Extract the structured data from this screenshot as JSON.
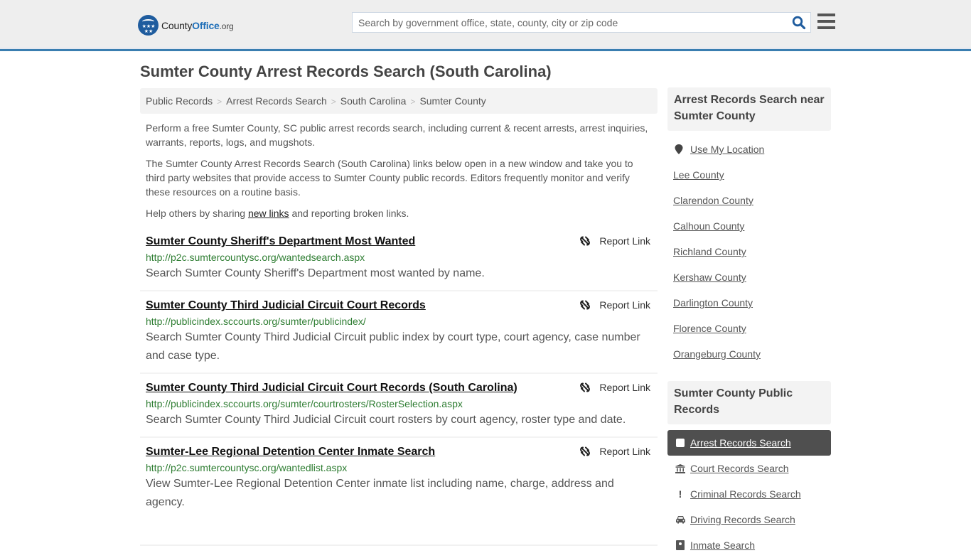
{
  "header": {
    "logo": {
      "name_part1": "County",
      "name_part2": "Office",
      "name_part3": ".org"
    },
    "search": {
      "placeholder": "Search by government office, state, county, city or zip code",
      "value": ""
    },
    "accent_color": "#3a7eb0"
  },
  "page": {
    "title": "Sumter County Arrest Records Search (South Carolina)",
    "breadcrumb": [
      "Public Records",
      "Arrest Records Search",
      "South Carolina",
      "Sumter County"
    ],
    "breadcrumb_separator": ">",
    "intro": [
      "Perform a free Sumter County, SC public arrest records search, including current & recent arrests, arrest inquiries, warrants, reports, logs, and mugshots.",
      "The Sumter County Arrest Records Search (South Carolina) links below open in a new window and take you to third party websites that provide access to Sumter County public records. Editors frequently monitor and verify these resources on a routine basis."
    ],
    "help": {
      "before": "Help others by sharing ",
      "link": "new links",
      "after": " and reporting broken links."
    }
  },
  "results": [
    {
      "title": "Sumter County Sheriff's Department Most Wanted",
      "url": "http://p2c.sumtercountysc.org/wantedsearch.aspx",
      "description": "Search Sumter County Sheriff's Department most wanted by name.",
      "report_label": "Report Link"
    },
    {
      "title": "Sumter County Third Judicial Circuit Court Records",
      "url": "http://publicindex.sccourts.org/sumter/publicindex/",
      "description": "Search Sumter County Third Judicial Circuit public index by court type, court agency, case number and case type.",
      "report_label": "Report Link"
    },
    {
      "title": "Sumter County Third Judicial Circuit Court Records (South Carolina)",
      "url": "http://publicindex.sccourts.org/sumter/courtrosters/RosterSelection.aspx",
      "description": "Search Sumter County Third Judicial Circuit court rosters by court agency, roster type and date.",
      "report_label": "Report Link"
    },
    {
      "title": "Sumter-Lee Regional Detention Center Inmate Search",
      "url": "http://p2c.sumtercountysc.org/wantedlist.aspx",
      "description": "View Sumter-Lee Regional Detention Center inmate list including name, charge, address and agency.",
      "report_label": "Report Link"
    }
  ],
  "sidebar": {
    "nearby_heading": "Arrest Records Search near Sumter County",
    "use_location": "Use My Location",
    "nearby": [
      "Lee County",
      "Clarendon County",
      "Calhoun County",
      "Richland County",
      "Kershaw County",
      "Darlington County",
      "Florence County",
      "Orangeburg County"
    ],
    "public_heading": "Sumter County Public Records",
    "public_records": [
      {
        "label": "Arrest Records Search",
        "icon": "square-icon",
        "active": true
      },
      {
        "label": "Court Records Search",
        "icon": "courthouse-icon",
        "active": false
      },
      {
        "label": "Criminal Records Search",
        "icon": "exclamation-icon",
        "active": false
      },
      {
        "label": "Driving Records Search",
        "icon": "car-icon",
        "active": false
      },
      {
        "label": "Inmate Search",
        "icon": "id-card-icon",
        "active": false
      }
    ]
  }
}
